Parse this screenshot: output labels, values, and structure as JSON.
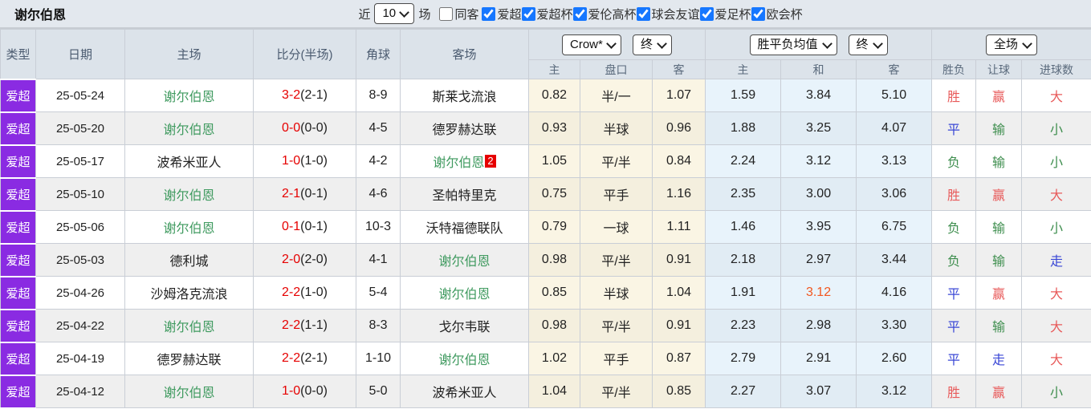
{
  "colors": {
    "accent_purple": "#8a2be2",
    "team_green": "#3f9a5f",
    "score_red": "#e60000",
    "result_red": "#e85a5a",
    "result_blue": "#3a47d6",
    "result_green": "#3e8e4e",
    "europe_highlight_orange": "#f2571f",
    "checkbox_blue": "#1677ff",
    "header_bg": "#dce3ea",
    "topbar_bg": "#e3e8ee",
    "row_alt_bg": "#efefef"
  },
  "topbar": {
    "title": "谢尔伯恩",
    "near_label": "近",
    "count_value": "10",
    "matches_label": "场",
    "filters": [
      {
        "label": "同客",
        "checked": false
      },
      {
        "label": "爱超",
        "checked": true
      },
      {
        "label": "爱超杯",
        "checked": true
      },
      {
        "label": "爱伦高杯",
        "checked": true
      },
      {
        "label": "球会友谊",
        "checked": true
      },
      {
        "label": "爱足杯",
        "checked": true
      },
      {
        "label": "欧会杯",
        "checked": true
      }
    ]
  },
  "table": {
    "main_headers": [
      "类型",
      "日期",
      "主场",
      "比分(半场)",
      "角球",
      "客场"
    ],
    "selects": {
      "bookmaker": "Crow*",
      "bookmaker_time": "终",
      "odds_type": "胜平负均值",
      "odds_time": "终",
      "scope": "全场"
    },
    "sub_headers": [
      "主",
      "盘口",
      "客",
      "主",
      "和",
      "客",
      "胜负",
      "让球",
      "进球数"
    ],
    "rows": [
      {
        "type": "爱超",
        "date": "25-05-24",
        "home": "谢尔伯恩",
        "home_hl": true,
        "score": "3-2",
        "half": "(2-1)",
        "corners": "8-9",
        "away": "斯莱戈流浪",
        "away_hl": false,
        "away_badge": "",
        "asian": [
          "0.82",
          "半/一",
          "1.07"
        ],
        "europe": [
          "1.59",
          "3.84",
          "5.10"
        ],
        "europe_hl": -1,
        "results": [
          [
            "胜",
            "red"
          ],
          [
            "赢",
            "red"
          ],
          [
            "大",
            "red"
          ]
        ]
      },
      {
        "type": "爱超",
        "date": "25-05-20",
        "home": "谢尔伯恩",
        "home_hl": true,
        "score": "0-0",
        "half": "(0-0)",
        "corners": "4-5",
        "away": "德罗赫达联",
        "away_hl": false,
        "away_badge": "",
        "asian": [
          "0.93",
          "半球",
          "0.96"
        ],
        "europe": [
          "1.88",
          "3.25",
          "4.07"
        ],
        "europe_hl": -1,
        "results": [
          [
            "平",
            "blue"
          ],
          [
            "输",
            "green"
          ],
          [
            "小",
            "green"
          ]
        ]
      },
      {
        "type": "爱超",
        "date": "25-05-17",
        "home": "波希米亚人",
        "home_hl": false,
        "score": "1-0",
        "half": "(1-0)",
        "corners": "4-2",
        "away": "谢尔伯恩",
        "away_hl": true,
        "away_badge": "2",
        "asian": [
          "1.05",
          "平/半",
          "0.84"
        ],
        "europe": [
          "2.24",
          "3.12",
          "3.13"
        ],
        "europe_hl": -1,
        "results": [
          [
            "负",
            "green"
          ],
          [
            "输",
            "green"
          ],
          [
            "小",
            "green"
          ]
        ]
      },
      {
        "type": "爱超",
        "date": "25-05-10",
        "home": "谢尔伯恩",
        "home_hl": true,
        "score": "2-1",
        "half": "(0-1)",
        "corners": "4-6",
        "away": "圣帕特里克",
        "away_hl": false,
        "away_badge": "",
        "asian": [
          "0.75",
          "平手",
          "1.16"
        ],
        "europe": [
          "2.35",
          "3.00",
          "3.06"
        ],
        "europe_hl": -1,
        "results": [
          [
            "胜",
            "red"
          ],
          [
            "赢",
            "red"
          ],
          [
            "大",
            "red"
          ]
        ]
      },
      {
        "type": "爱超",
        "date": "25-05-06",
        "home": "谢尔伯恩",
        "home_hl": true,
        "score": "0-1",
        "half": "(0-1)",
        "corners": "10-3",
        "away": "沃特福德联队",
        "away_hl": false,
        "away_badge": "",
        "asian": [
          "0.79",
          "一球",
          "1.11"
        ],
        "europe": [
          "1.46",
          "3.95",
          "6.75"
        ],
        "europe_hl": -1,
        "results": [
          [
            "负",
            "green"
          ],
          [
            "输",
            "green"
          ],
          [
            "小",
            "green"
          ]
        ]
      },
      {
        "type": "爱超",
        "date": "25-05-03",
        "home": "德利城",
        "home_hl": false,
        "score": "2-0",
        "half": "(2-0)",
        "corners": "4-1",
        "away": "谢尔伯恩",
        "away_hl": true,
        "away_badge": "",
        "asian": [
          "0.98",
          "平/半",
          "0.91"
        ],
        "europe": [
          "2.18",
          "2.97",
          "3.44"
        ],
        "europe_hl": -1,
        "results": [
          [
            "负",
            "green"
          ],
          [
            "输",
            "green"
          ],
          [
            "走",
            "blue"
          ]
        ]
      },
      {
        "type": "爱超",
        "date": "25-04-26",
        "home": "沙姆洛克流浪",
        "home_hl": false,
        "score": "2-2",
        "half": "(1-0)",
        "corners": "5-4",
        "away": "谢尔伯恩",
        "away_hl": true,
        "away_badge": "",
        "asian": [
          "0.85",
          "半球",
          "1.04"
        ],
        "europe": [
          "1.91",
          "3.12",
          "4.16"
        ],
        "europe_hl": 1,
        "results": [
          [
            "平",
            "blue"
          ],
          [
            "赢",
            "red"
          ],
          [
            "大",
            "red"
          ]
        ]
      },
      {
        "type": "爱超",
        "date": "25-04-22",
        "home": "谢尔伯恩",
        "home_hl": true,
        "score": "2-2",
        "half": "(1-1)",
        "corners": "8-3",
        "away": "戈尔韦联",
        "away_hl": false,
        "away_badge": "",
        "asian": [
          "0.98",
          "平/半",
          "0.91"
        ],
        "europe": [
          "2.23",
          "2.98",
          "3.30"
        ],
        "europe_hl": -1,
        "results": [
          [
            "平",
            "blue"
          ],
          [
            "输",
            "green"
          ],
          [
            "大",
            "red"
          ]
        ]
      },
      {
        "type": "爱超",
        "date": "25-04-19",
        "home": "德罗赫达联",
        "home_hl": false,
        "score": "2-2",
        "half": "(2-1)",
        "corners": "1-10",
        "away": "谢尔伯恩",
        "away_hl": true,
        "away_badge": "",
        "asian": [
          "1.02",
          "平手",
          "0.87"
        ],
        "europe": [
          "2.79",
          "2.91",
          "2.60"
        ],
        "europe_hl": -1,
        "results": [
          [
            "平",
            "blue"
          ],
          [
            "走",
            "blue"
          ],
          [
            "大",
            "red"
          ]
        ]
      },
      {
        "type": "爱超",
        "date": "25-04-12",
        "home": "谢尔伯恩",
        "home_hl": true,
        "score": "1-0",
        "half": "(0-0)",
        "corners": "5-0",
        "away": "波希米亚人",
        "away_hl": false,
        "away_badge": "",
        "asian": [
          "1.04",
          "平/半",
          "0.85"
        ],
        "europe": [
          "2.27",
          "3.07",
          "3.12"
        ],
        "europe_hl": -1,
        "results": [
          [
            "胜",
            "red"
          ],
          [
            "赢",
            "red"
          ],
          [
            "小",
            "green"
          ]
        ]
      }
    ]
  }
}
